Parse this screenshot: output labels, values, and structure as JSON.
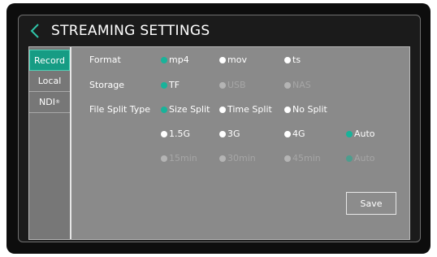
{
  "header": {
    "title": "STREAMING SETTINGS"
  },
  "sidebar": {
    "tabs": [
      {
        "label": "Record",
        "selected": true
      },
      {
        "label": "Local",
        "selected": false
      },
      {
        "label": "NDI",
        "superscript": "®",
        "selected": false
      }
    ]
  },
  "settings": {
    "format": {
      "label": "Format",
      "options": [
        "mp4",
        "mov",
        "ts"
      ],
      "selected": "mp4"
    },
    "storage": {
      "label": "Storage",
      "options": [
        "TF",
        "USB",
        "NAS"
      ],
      "selected": "TF",
      "disabled_options": [
        "USB",
        "NAS"
      ]
    },
    "file_split_type": {
      "label": "File Split Type",
      "options": [
        "Size Split",
        "Time Split",
        "No Split"
      ],
      "selected": "Size Split"
    },
    "size_split": {
      "options": [
        "1.5G",
        "3G",
        "4G",
        "Auto"
      ],
      "selected": "Auto"
    },
    "time_split": {
      "options": [
        "15min",
        "30min",
        "45min",
        "Auto"
      ],
      "selected": "Auto",
      "disabled": true
    }
  },
  "actions": {
    "save_label": "Save"
  },
  "colors": {
    "accent": "#18b39a",
    "active_tab": "#169c84",
    "panel": "#8a8a8a",
    "sidebar": "#777777",
    "screen_bg": "#1b1b1b"
  },
  "icons": {
    "back": "chevron-left-icon",
    "radio": "radio-dot-icon"
  }
}
